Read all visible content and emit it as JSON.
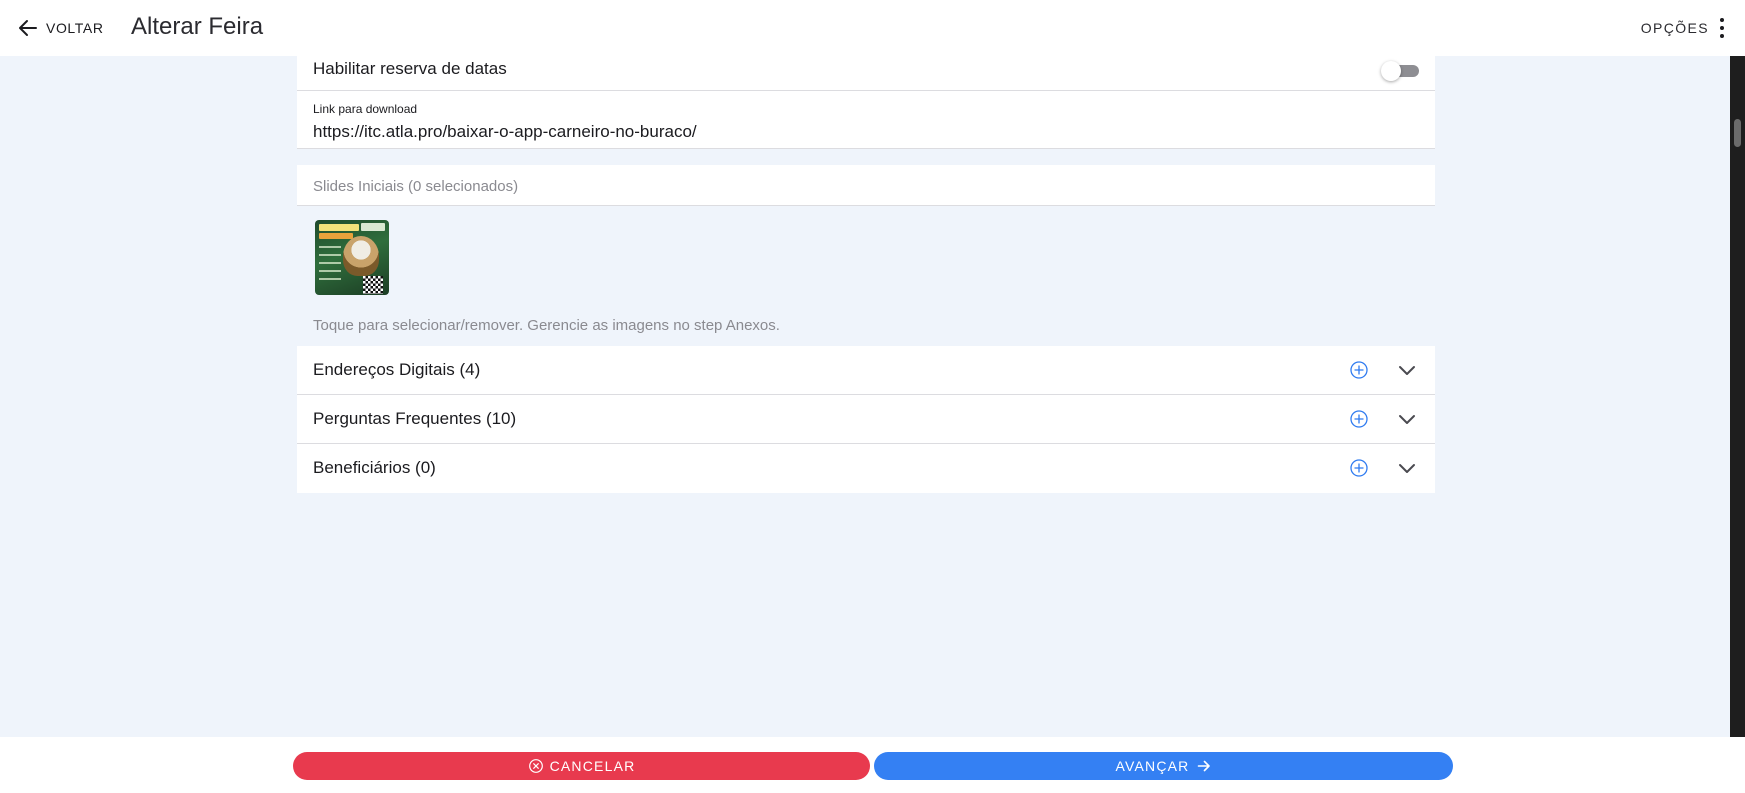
{
  "header": {
    "back_label": "VOLTAR",
    "title": "Alterar Feira",
    "options_label": "OPÇÕES"
  },
  "form": {
    "reserve_label": "Habilitar reserva de datas",
    "reserve_enabled": false,
    "link_label": "Link para download",
    "link_value": "https://itc.atla.pro/baixar-o-app-carneiro-no-buraco/",
    "slides_label": "Slides Iniciais (0 selecionados)",
    "slides_hint": "Toque para selecionar/remover. Gerencie as imagens no step Anexos."
  },
  "sections": [
    {
      "label": "Endereços Digitais (4)"
    },
    {
      "label": "Perguntas Frequentes (10)"
    },
    {
      "label": "Beneficiários (0)"
    }
  ],
  "footer": {
    "cancel_label": "CANCELAR",
    "next_label": "AVANÇAR"
  },
  "colors": {
    "background": "#eff4fb",
    "cancel": "#e83a4e",
    "primary": "#3480f3",
    "icon_blue": "#2f7bf0"
  },
  "icons": {
    "back": "arrow-left-icon",
    "options": "more-vertical-icon",
    "add": "add-circle-outline-icon",
    "expand": "chevron-down-icon",
    "cancel": "close-circle-outline-icon",
    "next": "arrow-right-icon"
  }
}
